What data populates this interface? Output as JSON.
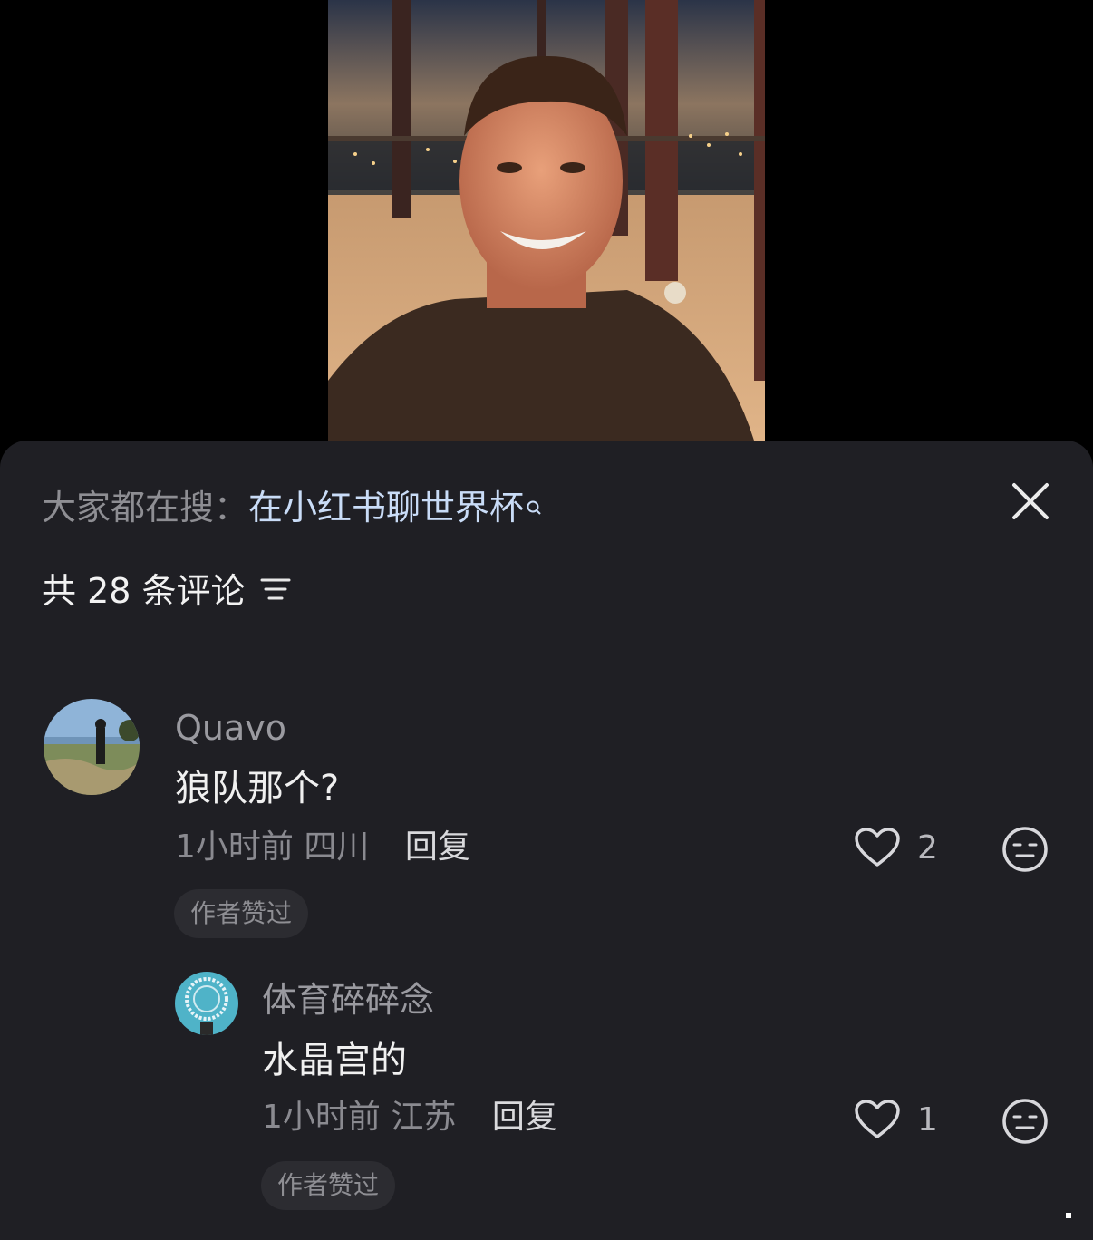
{
  "search_hint": {
    "prefix": "大家都在搜：",
    "term": "在小红书聊世界杯"
  },
  "comment_count_label": "共 28 条评论",
  "comments": [
    {
      "username": "Quavo",
      "text": "狼队那个?",
      "time": "1小时前",
      "location": "四川",
      "reply_label": "回复",
      "likes": "2",
      "badge": "作者赞过",
      "replies": [
        {
          "username": "体育碎碎念",
          "text": "水晶宫的",
          "time": "1小时前",
          "location": "江苏",
          "reply_label": "回复",
          "likes": "1",
          "badge": "作者赞过"
        }
      ]
    }
  ],
  "icons": {
    "close": "close-icon",
    "sort": "sort-icon",
    "like": "heart-icon",
    "react": "meh-face-icon",
    "search": "search-icon"
  },
  "colors": {
    "sheet_bg": "#1f1f24",
    "search_term": "#c9dcf7",
    "badge_bg": "#2c2c31"
  }
}
